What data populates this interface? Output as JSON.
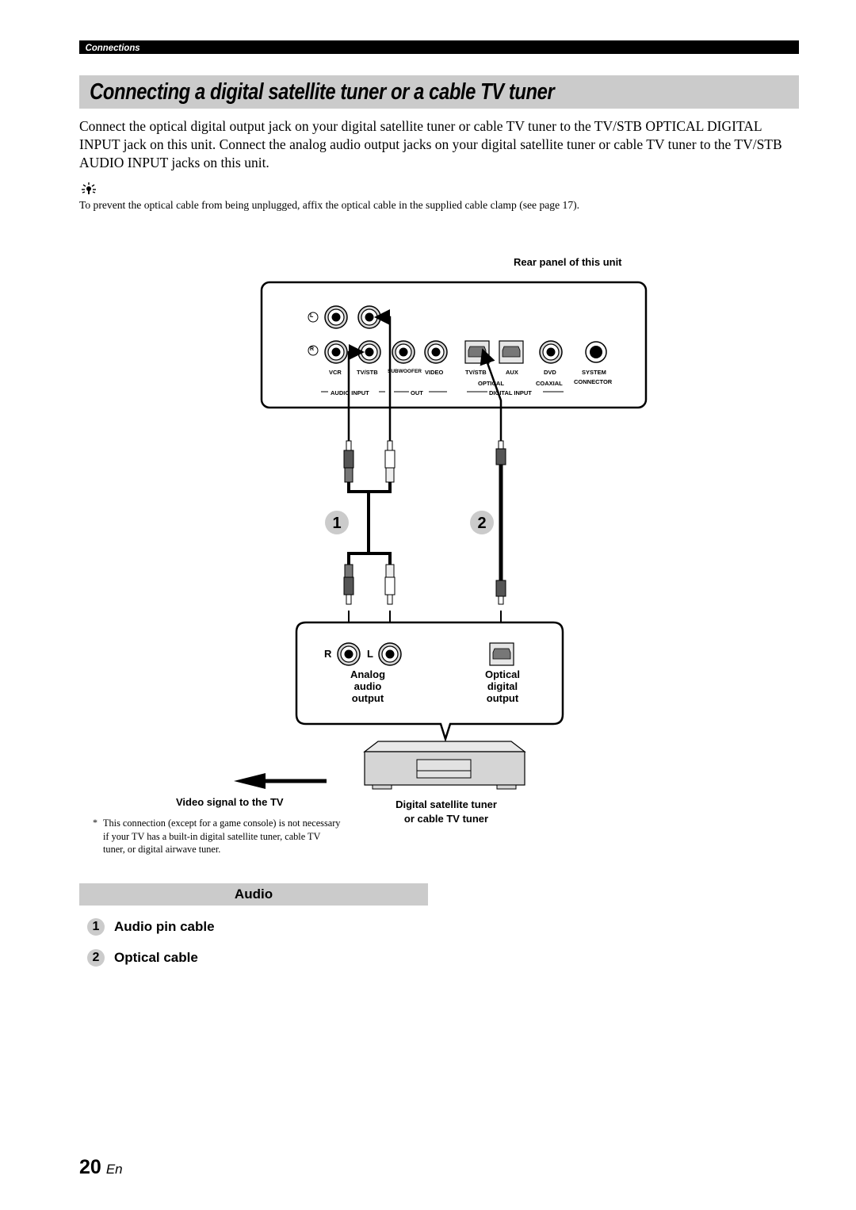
{
  "header": {
    "section": "Connections",
    "title": "Connecting a digital satellite tuner or a cable TV tuner"
  },
  "intro": {
    "paragraph": "Connect the optical digital output jack on your digital satellite tuner or cable TV tuner to the TV/STB OPTICAL DIGITAL INPUT jack on this unit. Connect the analog audio output jacks on your digital satellite tuner or cable TV tuner to the TV/STB AUDIO INPUT jacks on this unit.",
    "tip_icon": "lightbulb-icon",
    "tip": "To prevent the optical cable from being unplugged, affix the optical cable in the supplied cable clamp (see page 17)."
  },
  "diagram": {
    "rear_panel_caption": "Rear panel of this unit",
    "panel": {
      "channel_l": "L",
      "channel_r": "R",
      "jacks": [
        "VCR",
        "TV/STB",
        "SUBWOOFER",
        "VIDEO",
        "TV/STB",
        "AUX",
        "DVD",
        "SYSTEM"
      ],
      "system_sub": "CONNECTOR",
      "optical_sub": "OPTICAL",
      "coaxial_sub": "COAXIAL",
      "groups": {
        "audio_input": "AUDIO INPUT",
        "out": "OUT",
        "digital_input": "DIGITAL INPUT"
      }
    },
    "cable_numbers": [
      "1",
      "2"
    ],
    "device_panel": {
      "r": "R",
      "l": "L",
      "analog_label": [
        "Analog",
        "audio",
        "output"
      ],
      "optical_label": [
        "Optical",
        "digital",
        "output"
      ]
    },
    "video_signal": "Video signal to the TV",
    "device_caption": [
      "Digital satellite tuner",
      "or cable TV tuner"
    ],
    "footnote_mark": "*",
    "footnote": "This connection (except for a game console) is not necessary if your TV has a built-in digital satellite tuner, cable TV tuner, or digital airwave tuner."
  },
  "legend": {
    "heading": "Audio",
    "items": [
      {
        "num": "1",
        "label": "Audio pin cable"
      },
      {
        "num": "2",
        "label": "Optical cable"
      }
    ]
  },
  "footer": {
    "page": "20",
    "lang": "En"
  }
}
